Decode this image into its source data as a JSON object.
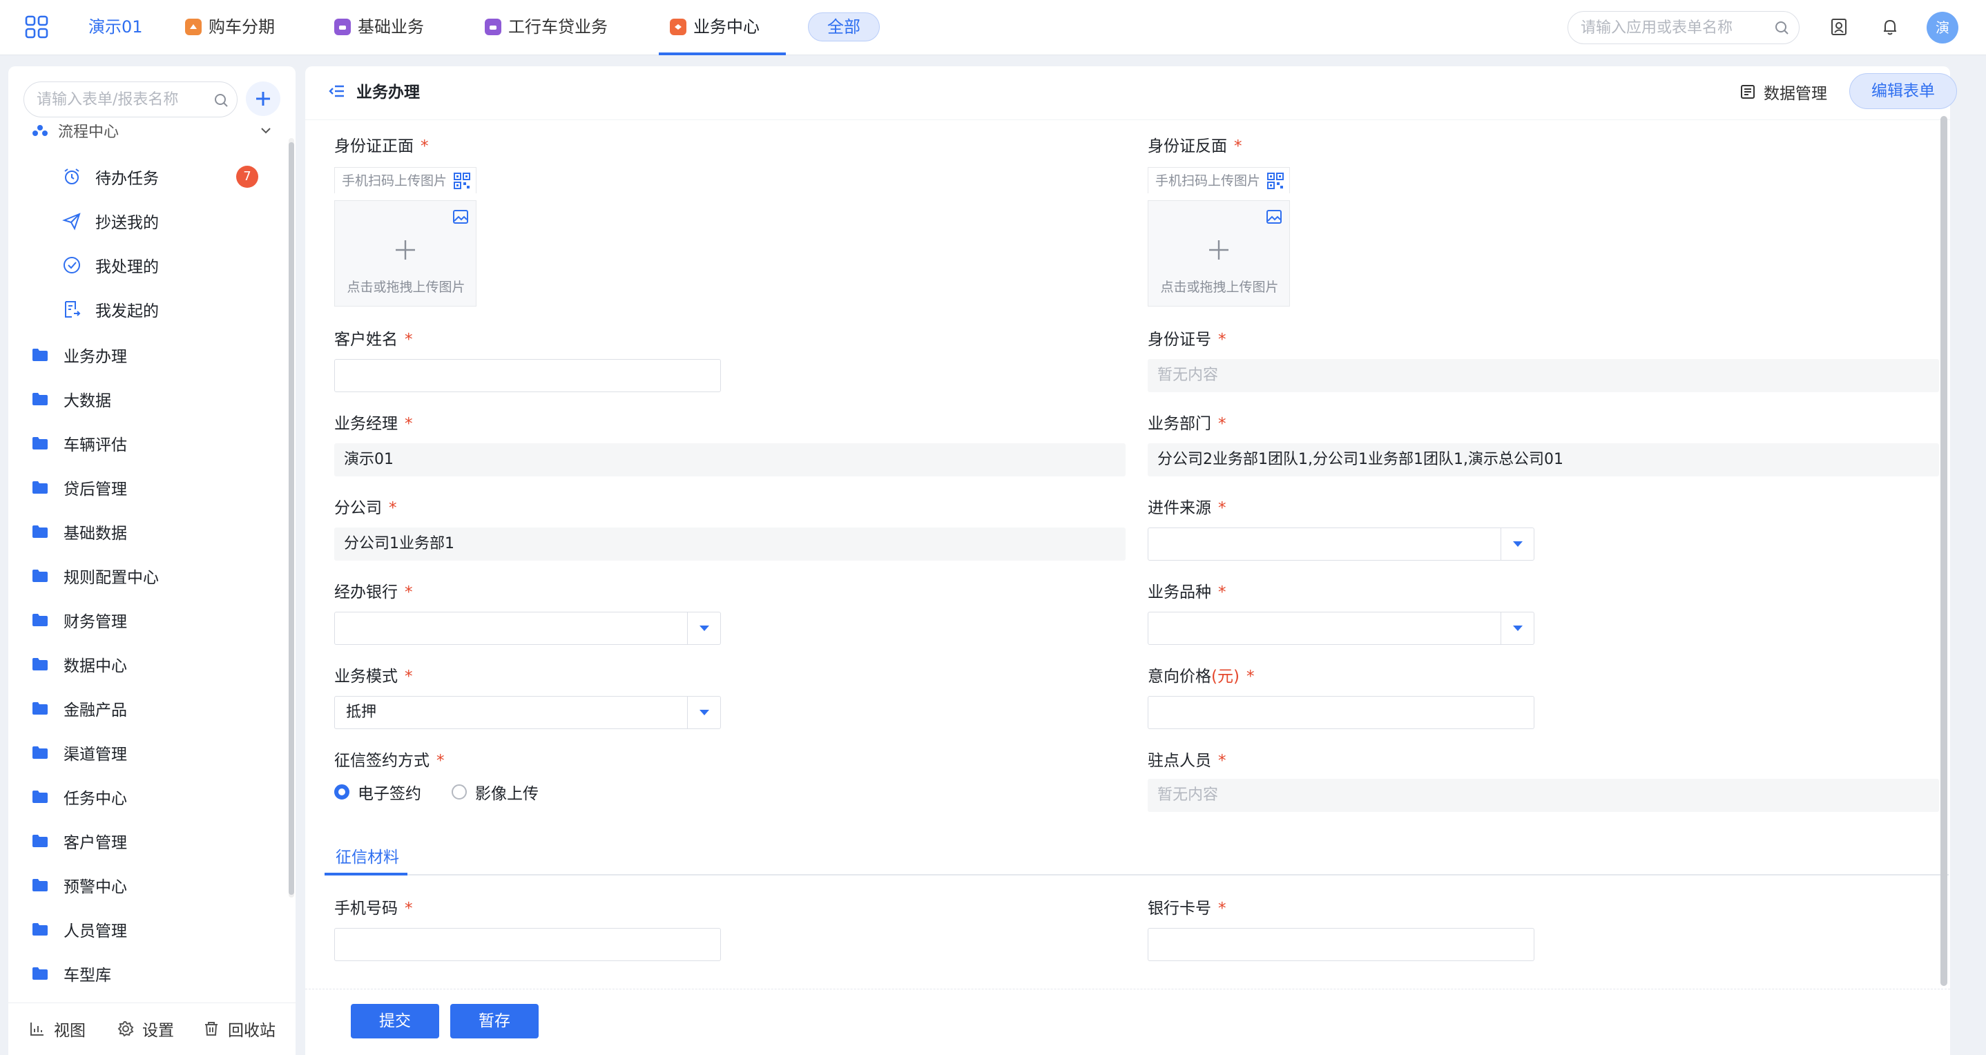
{
  "topbar": {
    "org_name": "演示01",
    "tabs": [
      {
        "label": "购车分期",
        "color": "#f08a3c"
      },
      {
        "label": "基础业务",
        "color": "#8e5ad6"
      },
      {
        "label": "工行车贷业务",
        "color": "#8e5ad6"
      },
      {
        "label": "业务中心",
        "color": "#f06a3c",
        "active": true
      }
    ],
    "all_label": "全部",
    "search_placeholder": "请输入应用或表单名称",
    "avatar_text": "演"
  },
  "sidebar": {
    "search_placeholder": "请输入表单/报表名称",
    "flow_group": "流程中心",
    "sub_items": [
      {
        "label": "待办任务",
        "icon": "alarm-clock-icon",
        "badge": "7"
      },
      {
        "label": "抄送我的",
        "icon": "send-icon"
      },
      {
        "label": "我处理的",
        "icon": "check-circle-icon"
      },
      {
        "label": "我发起的",
        "icon": "document-icon"
      }
    ],
    "folders": [
      "业务办理",
      "大数据",
      "车辆评估",
      "贷后管理",
      "基础数据",
      "规则配置中心",
      "财务管理",
      "数据中心",
      "金融产品",
      "渠道管理",
      "任务中心",
      "客户管理",
      "预警中心",
      "人员管理",
      "车型库"
    ],
    "bottom": {
      "view": "视图",
      "settings": "设置",
      "recycle": "回收站"
    }
  },
  "page": {
    "title": "业务办理",
    "data_mgmt": "数据管理",
    "edit_form": "编辑表单"
  },
  "form": {
    "id_front": {
      "label": "身份证正面",
      "hint": "手机扫码上传图片",
      "upload_text": "点击或拖拽上传图片"
    },
    "id_back": {
      "label": "身份证反面",
      "hint": "手机扫码上传图片",
      "upload_text": "点击或拖拽上传图片"
    },
    "customer_name": {
      "label": "客户姓名",
      "value": ""
    },
    "id_number": {
      "label": "身份证号",
      "placeholder": "暂无内容"
    },
    "manager": {
      "label": "业务经理",
      "value": "演示01"
    },
    "department": {
      "label": "业务部门",
      "value": "分公司2业务部1团队1,分公司1业务部1团队1,演示总公司01"
    },
    "branch": {
      "label": "分公司",
      "value": "分公司1业务部1"
    },
    "source": {
      "label": "进件来源",
      "value": ""
    },
    "bank": {
      "label": "经办银行",
      "value": ""
    },
    "product": {
      "label": "业务品种",
      "value": ""
    },
    "mode": {
      "label": "业务模式",
      "value": "抵押"
    },
    "price": {
      "label": "意向价格",
      "unit": "(元)",
      "value": ""
    },
    "credit_sign": {
      "label": "征信签约方式",
      "options": [
        "电子签约",
        "影像上传"
      ],
      "selected": "电子签约"
    },
    "resident": {
      "label": "驻点人员",
      "placeholder": "暂无内容"
    },
    "section_tab": "征信材料",
    "phone": {
      "label": "手机号码",
      "value": ""
    },
    "bank_card": {
      "label": "银行卡号",
      "value": ""
    },
    "required_mark": "*"
  },
  "footer": {
    "submit": "提交",
    "save_draft": "暂存"
  },
  "colors": {
    "accent": "#2f6ff0",
    "required": "#e5482d",
    "badge": "#ee5a3c"
  }
}
